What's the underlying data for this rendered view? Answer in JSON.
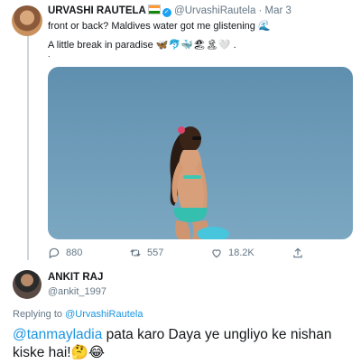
{
  "tweet": {
    "display_name": "URVASHI RAUTELA",
    "flag_icon": "india-flag-icon",
    "verified_icon": "verified-badge-icon",
    "handle_date": "@UrvashiRautela · Mar 3",
    "text_line1": "front or back? Maldives water got me glistening",
    "text_line1_icon": "wave-icon",
    "text_line2": "A little break in paradise 🦋🐬🐳🏖🏝🤍 .",
    "text_line3": ".",
    "media_icon": "beach-photo",
    "stats": {
      "replies": "880",
      "retweets": "557",
      "likes": "18.2K"
    }
  },
  "reply": {
    "display_name": "ANKIT RAJ",
    "handle": "@ankit_1997",
    "replying_prefix": "Replying to",
    "replying_to": "@UrvashiRautela",
    "mention": "@tanmayladia",
    "body": " pata karo Daya ye ungliyo ke nishan kiske hai!🤔😂"
  },
  "colors": {
    "link": "#1b95e0",
    "secondary_text": "#657786",
    "verified": "#1da1f2"
  }
}
